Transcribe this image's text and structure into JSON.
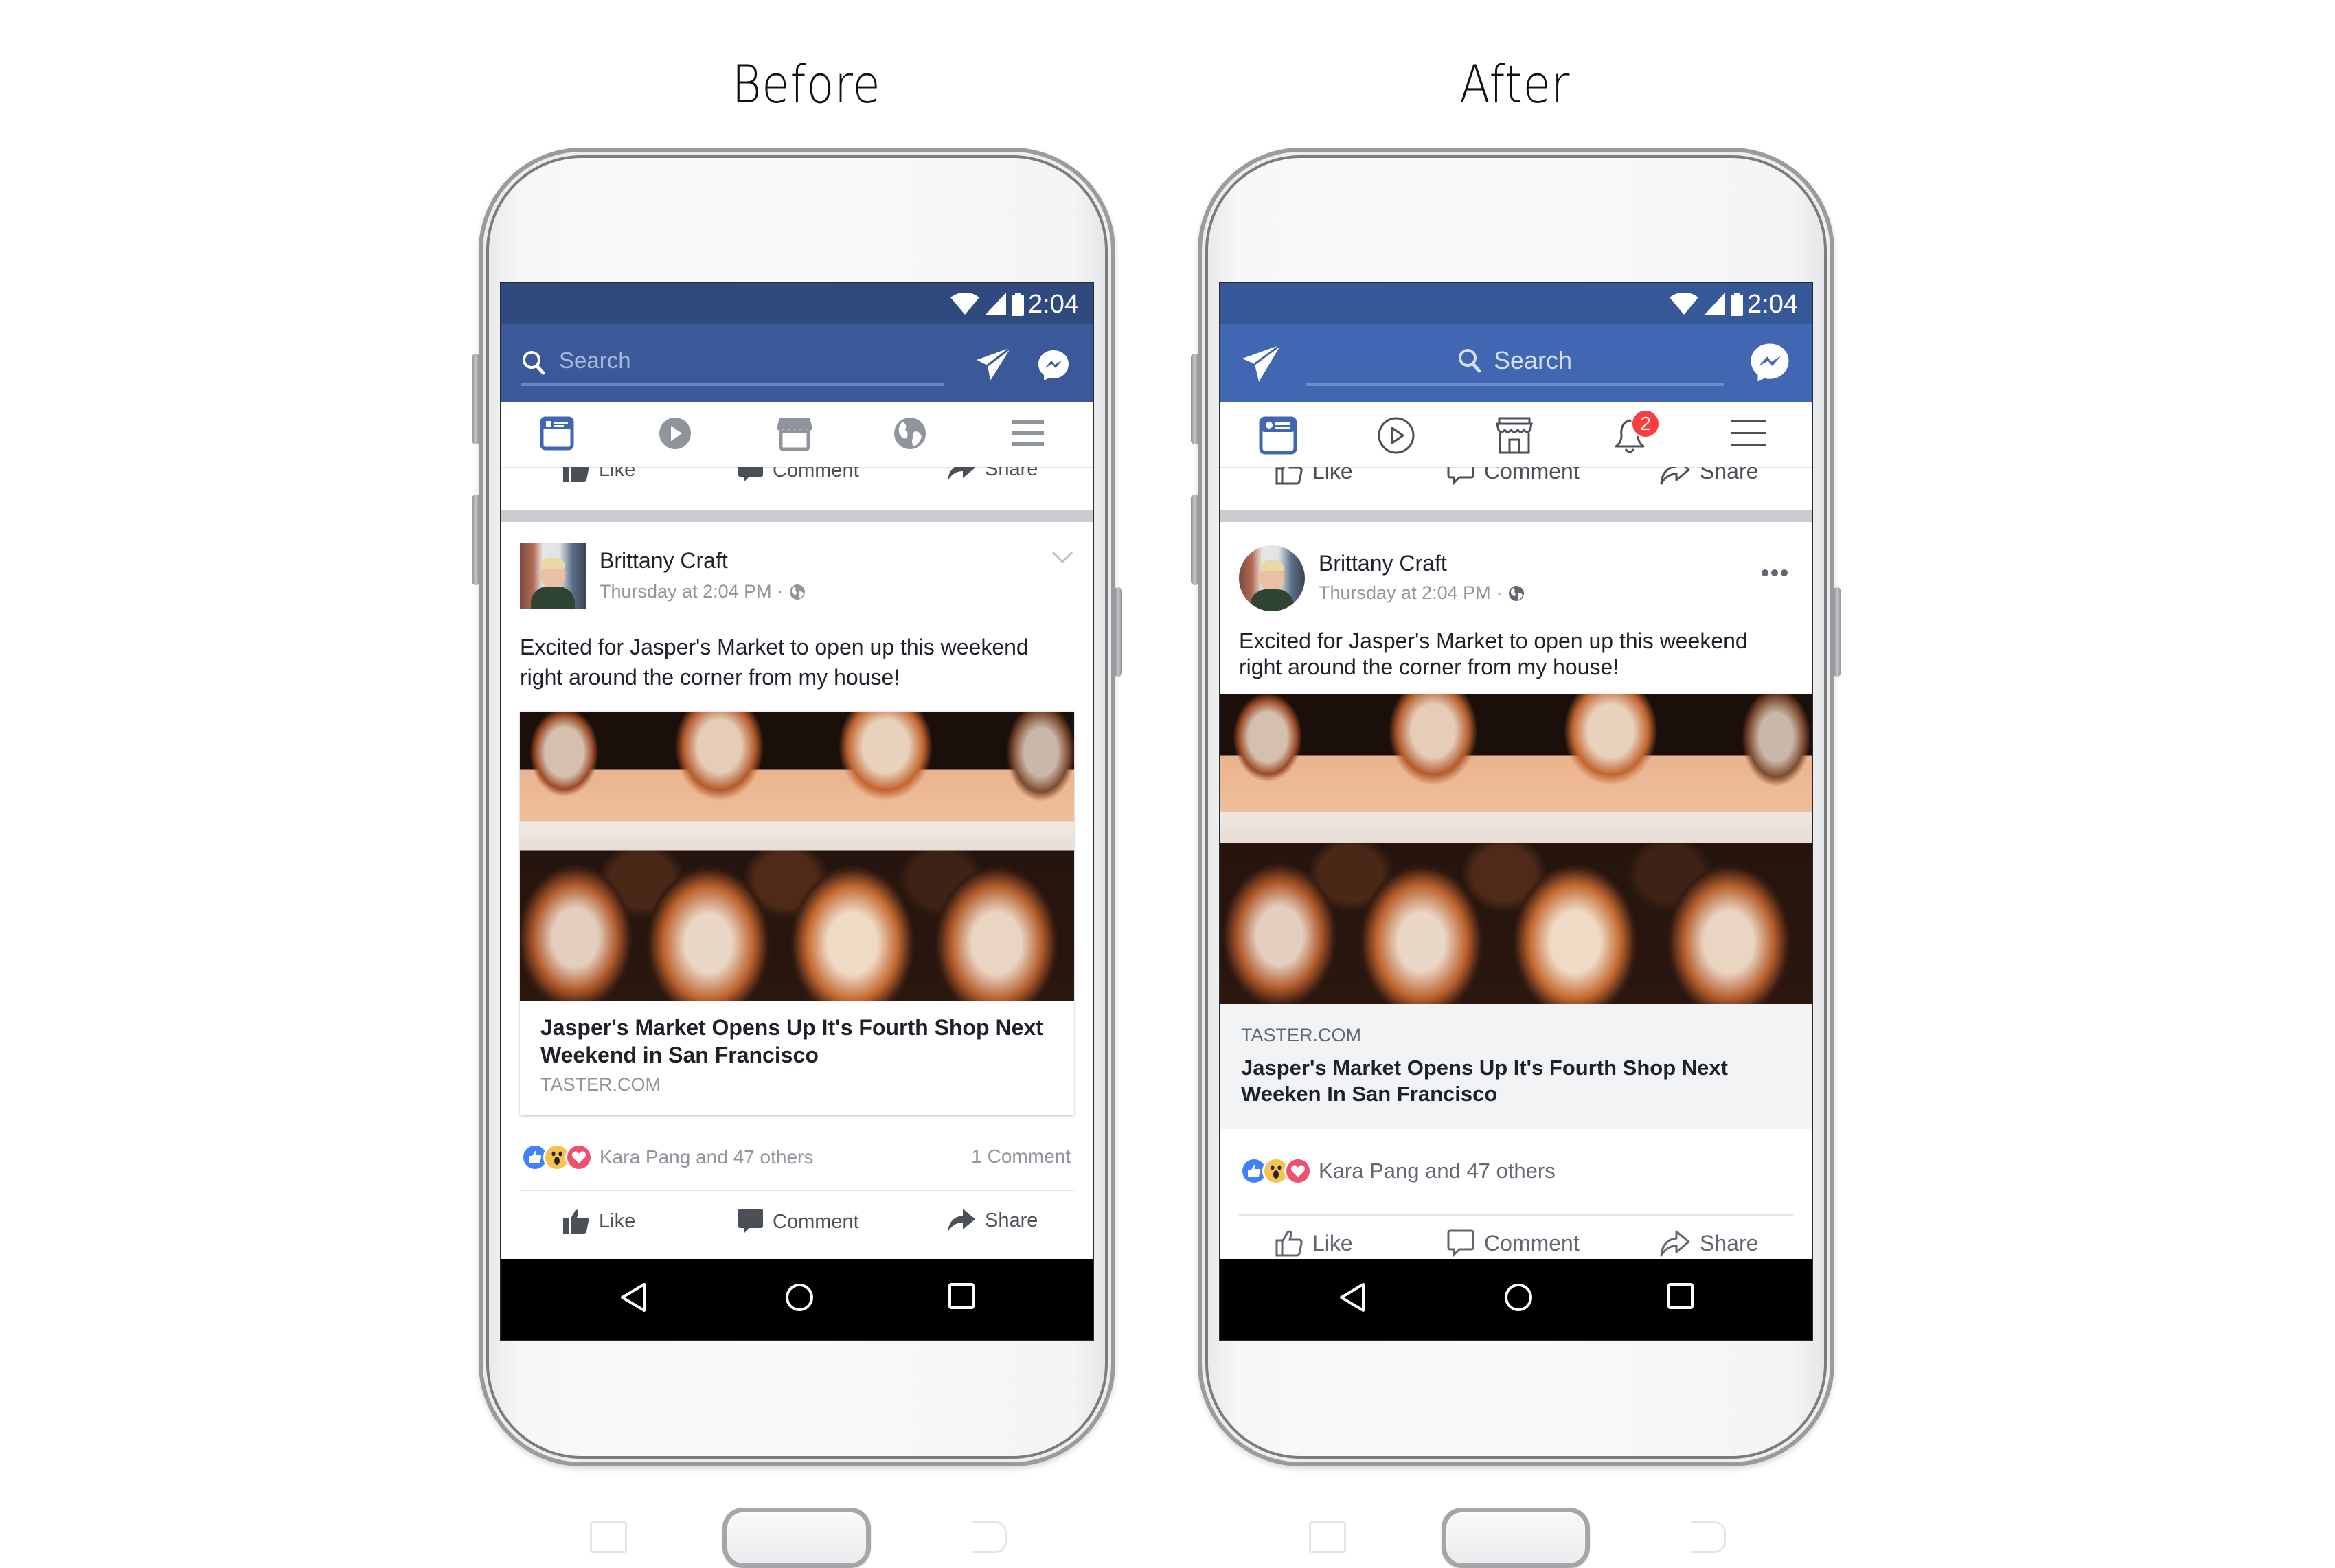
{
  "captions": {
    "before": "Before",
    "after": "After"
  },
  "colors": {
    "before_status": "#30497e",
    "before_header": "#3b5998",
    "after_status": "#365899",
    "after_header": "#4267b2",
    "active_tab": "#4267b2",
    "badge": "#fa3e3e",
    "like_blue": "#4080ff",
    "wow_yellow": "#f7c34f",
    "love_red": "#f0506e"
  },
  "before": {
    "status": {
      "time": "2:04"
    },
    "header": {
      "search_placeholder": "Search"
    },
    "tabs": [
      "news-feed",
      "watch",
      "marketplace",
      "notifications-globe",
      "menu"
    ],
    "previous_post_actions": {
      "like": "Like",
      "comment": "Comment",
      "share": "Share"
    },
    "post": {
      "author": "Brittany Craft",
      "timestamp": "Thursday at 2:04 PM",
      "separator": "·",
      "privacy": "public",
      "body_line1": "Excited for Jasper's Market to open up this weekend",
      "body_line2": "right around the corner from my house!",
      "link_title_line1": "Jasper's Market Opens Up It's Fourth Shop Next",
      "link_title_line2": "Weekend in San Francisco",
      "link_domain": "TASTER.COM",
      "reactions_text": "Kara Pang and 47 others",
      "comment_count": "1 Comment",
      "actions": {
        "like": "Like",
        "comment": "Comment",
        "share": "Share"
      }
    }
  },
  "after": {
    "status": {
      "time": "2:04"
    },
    "header": {
      "search_placeholder": "Search"
    },
    "tabs": [
      "news-feed",
      "watch",
      "marketplace",
      "notifications",
      "menu"
    ],
    "notification_badge": "2",
    "previous_post_actions": {
      "like": "Like",
      "comment": "Comment",
      "share": "Share"
    },
    "post": {
      "author": "Brittany Craft",
      "timestamp": "Thursday at 2:04 PM",
      "separator": "·",
      "privacy": "public",
      "body_line1": "Excited for Jasper's Market to open up this weekend",
      "body_line2": "right around the corner from my house!",
      "link_domain": "TASTER.COM",
      "link_title_line1": "Jasper's Market Opens Up It's Fourth Shop Next",
      "link_title_line2": "Weeken In San Francisco",
      "reactions_text": "Kara Pang and 47 others",
      "actions": {
        "like": "Like",
        "comment": "Comment",
        "share": "Share"
      }
    }
  }
}
